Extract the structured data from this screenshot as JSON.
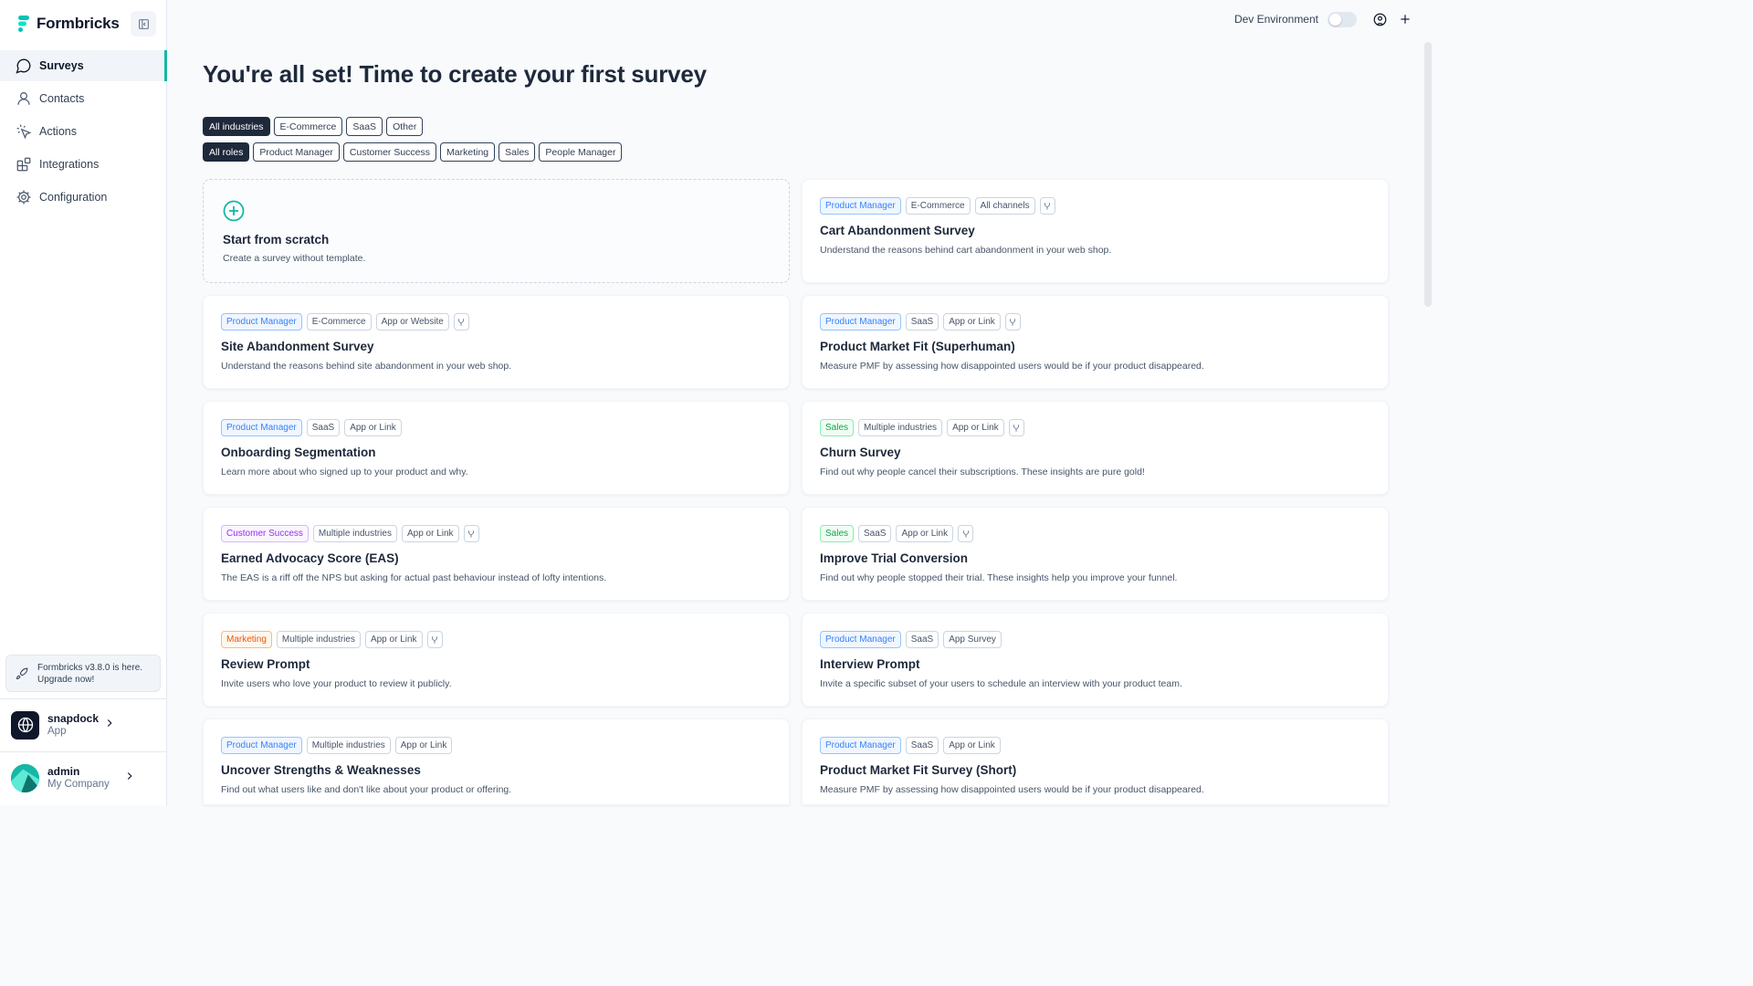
{
  "brand": {
    "name": "Formbricks"
  },
  "sidebar": {
    "items": [
      {
        "label": "Surveys",
        "icon": "message-circle-icon",
        "active": true
      },
      {
        "label": "Contacts",
        "icon": "user-icon",
        "active": false
      },
      {
        "label": "Actions",
        "icon": "mouse-pointer-click-icon",
        "active": false
      },
      {
        "label": "Integrations",
        "icon": "blocks-icon",
        "active": false
      },
      {
        "label": "Configuration",
        "icon": "gear-icon",
        "active": false
      }
    ],
    "upgrade": {
      "line1": "Formbricks v3.8.0 is here.",
      "line2": "Upgrade now!"
    },
    "project": {
      "name": "snapdock",
      "sub": "App"
    },
    "user": {
      "name": "admin",
      "sub": "My Company"
    }
  },
  "topbar": {
    "env_label": "Dev Environment"
  },
  "main": {
    "heading": "You're all set! Time to create your first survey",
    "industry_filters": [
      "All industries",
      "E-Commerce",
      "SaaS",
      "Other"
    ],
    "role_filters": [
      "All roles",
      "Product Manager",
      "Customer Success",
      "Marketing",
      "Sales",
      "People Manager"
    ],
    "selected_industry": "All industries",
    "selected_role": "All roles",
    "scratch": {
      "title": "Start from scratch",
      "desc": "Create a survey without template."
    },
    "templates": [
      {
        "role": "Product Manager",
        "role_color": "blue",
        "industry": "E-Commerce",
        "channel": "All channels",
        "branch": true,
        "title": "Cart Abandonment Survey",
        "desc": "Understand the reasons behind cart abandonment in your web shop."
      },
      {
        "role": "Product Manager",
        "role_color": "blue",
        "industry": "E-Commerce",
        "channel": "App or Website",
        "branch": true,
        "title": "Site Abandonment Survey",
        "desc": "Understand the reasons behind site abandonment in your web shop."
      },
      {
        "role": "Product Manager",
        "role_color": "blue",
        "industry": "SaaS",
        "channel": "App or Link",
        "branch": true,
        "title": "Product Market Fit (Superhuman)",
        "desc": "Measure PMF by assessing how disappointed users would be if your product disappeared."
      },
      {
        "role": "Product Manager",
        "role_color": "blue",
        "industry": "SaaS",
        "channel": "App or Link",
        "branch": false,
        "title": "Onboarding Segmentation",
        "desc": "Learn more about who signed up to your product and why."
      },
      {
        "role": "Sales",
        "role_color": "green",
        "industry": "Multiple industries",
        "channel": "App or Link",
        "branch": true,
        "title": "Churn Survey",
        "desc": "Find out why people cancel their subscriptions. These insights are pure gold!"
      },
      {
        "role": "Customer Success",
        "role_color": "purple",
        "industry": "Multiple industries",
        "channel": "App or Link",
        "branch": true,
        "title": "Earned Advocacy Score (EAS)",
        "desc": "The EAS is a riff off the NPS but asking for actual past behaviour instead of lofty intentions."
      },
      {
        "role": "Sales",
        "role_color": "green",
        "industry": "SaaS",
        "channel": "App or Link",
        "branch": true,
        "title": "Improve Trial Conversion",
        "desc": "Find out why people stopped their trial. These insights help you improve your funnel."
      },
      {
        "role": "Marketing",
        "role_color": "orange",
        "industry": "Multiple industries",
        "channel": "App or Link",
        "branch": true,
        "title": "Review Prompt",
        "desc": "Invite users who love your product to review it publicly."
      },
      {
        "role": "Product Manager",
        "role_color": "blue",
        "industry": "SaaS",
        "channel": "App Survey",
        "branch": false,
        "title": "Interview Prompt",
        "desc": "Invite a specific subset of your users to schedule an interview with your product team."
      },
      {
        "role": "Product Manager",
        "role_color": "blue",
        "industry": "Multiple industries",
        "channel": "App or Link",
        "branch": false,
        "title": "Uncover Strengths & Weaknesses",
        "desc": "Find out what users like and don't like about your product or offering."
      },
      {
        "role": "Product Manager",
        "role_color": "blue",
        "industry": "SaaS",
        "channel": "App or Link",
        "branch": false,
        "title": "Product Market Fit Survey (Short)",
        "desc": "Measure PMF by assessing how disappointed users would be if your product disappeared."
      }
    ]
  }
}
